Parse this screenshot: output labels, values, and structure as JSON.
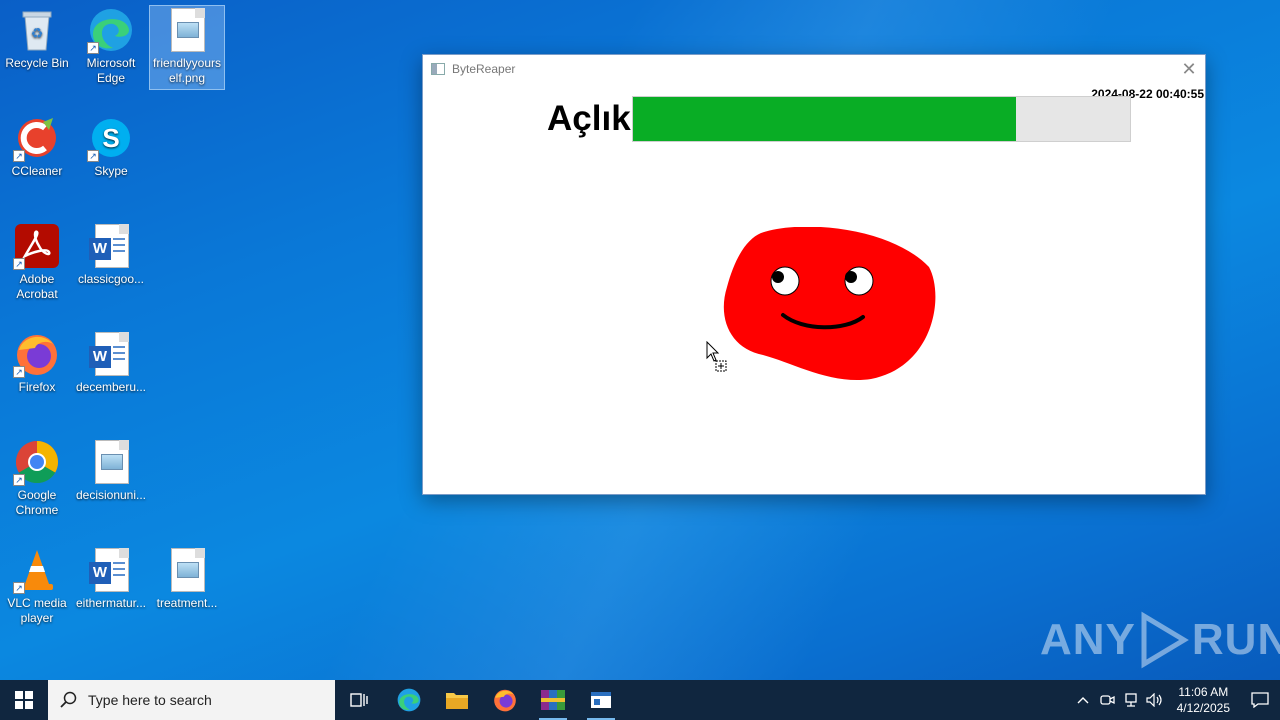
{
  "desktop": {
    "icons": [
      {
        "label": "Recycle Bin"
      },
      {
        "label": "Microsoft Edge"
      },
      {
        "label": "friendlyyourself.png",
        "line1": "friendlyyours",
        "line2": "elf.png"
      },
      {
        "label": "CCleaner"
      },
      {
        "label": "Skype"
      },
      {
        "label": "Adobe Acrobat",
        "line1": "Adobe",
        "line2": "Acrobat"
      },
      {
        "label": "classicgoo..."
      },
      {
        "label": "Firefox"
      },
      {
        "label": "decemberu..."
      },
      {
        "label": "Google Chrome",
        "line1": "Google",
        "line2": "Chrome"
      },
      {
        "label": "decisionuni..."
      },
      {
        "label": "VLC media player",
        "line1": "VLC media",
        "line2": "player"
      },
      {
        "label": "eithermatur..."
      },
      {
        "label": "treatment..."
      }
    ],
    "edge_line1": "Microsoft",
    "edge_line2": "Edge"
  },
  "window": {
    "title": "ByteReaper",
    "close_glyph": "✕",
    "timestamp": "2024-08-22 00:40:55",
    "hunger_label": "Açlık",
    "hunger_level_fraction": 0.77,
    "bar_fill_color": "#09ad25",
    "pet_color": "#ff0000"
  },
  "watermark": {
    "left": "ANY",
    "right": "RUN"
  },
  "taskbar": {
    "search_placeholder": "Type here to search",
    "clock_time": "11:06 AM",
    "clock_date": "4/12/2025",
    "pinned": [
      "task-view-icon",
      "edge-icon",
      "file-explorer-icon",
      "firefox-icon",
      "winrar-icon",
      "bytereaper-app-icon"
    ]
  }
}
